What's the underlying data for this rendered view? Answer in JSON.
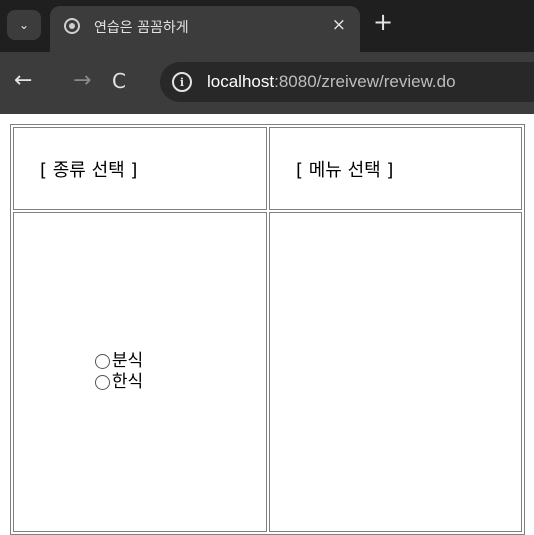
{
  "browser": {
    "tab": {
      "title": "연습은 꼼꼼하게",
      "close": "×"
    },
    "newtab": "+",
    "tab_menu": "⌄",
    "nav": {
      "back": "←",
      "forward": "→",
      "reload": "C"
    },
    "url": {
      "host": "localhost",
      "rest": ":8080/zreivew/review.do"
    },
    "info": "i"
  },
  "page": {
    "headers": {
      "category": "[ 종류 선택 ]",
      "menu": "[ 메뉴 선택 ]"
    },
    "options": [
      {
        "label": "분식",
        "checked": false
      },
      {
        "label": "한식",
        "checked": false
      }
    ]
  }
}
